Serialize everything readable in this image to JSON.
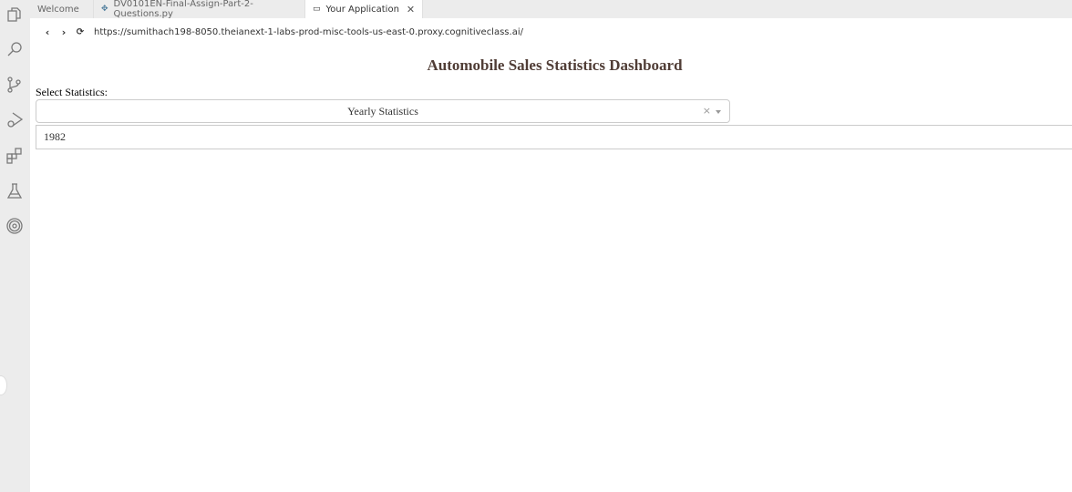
{
  "tabs": [
    {
      "label": "Welcome",
      "icon": "none"
    },
    {
      "label": "DV0101EN-Final-Assign-Part-2-Questions.py",
      "icon": "python-icon"
    },
    {
      "label": "Your Application",
      "icon": "browser-icon",
      "active": true
    }
  ],
  "browser": {
    "url": "https://sumithach198-8050.theianext-1-labs-prod-misc-tools-us-east-0.proxy.cognitiveclass.ai/"
  },
  "app": {
    "title": "Automobile Sales Statistics Dashboard",
    "select_label": "Select Statistics:",
    "statistics_value": "Yearly Statistics",
    "clear_symbol": "×",
    "year_value": "1982"
  },
  "colors": {
    "title": "#503D36"
  }
}
